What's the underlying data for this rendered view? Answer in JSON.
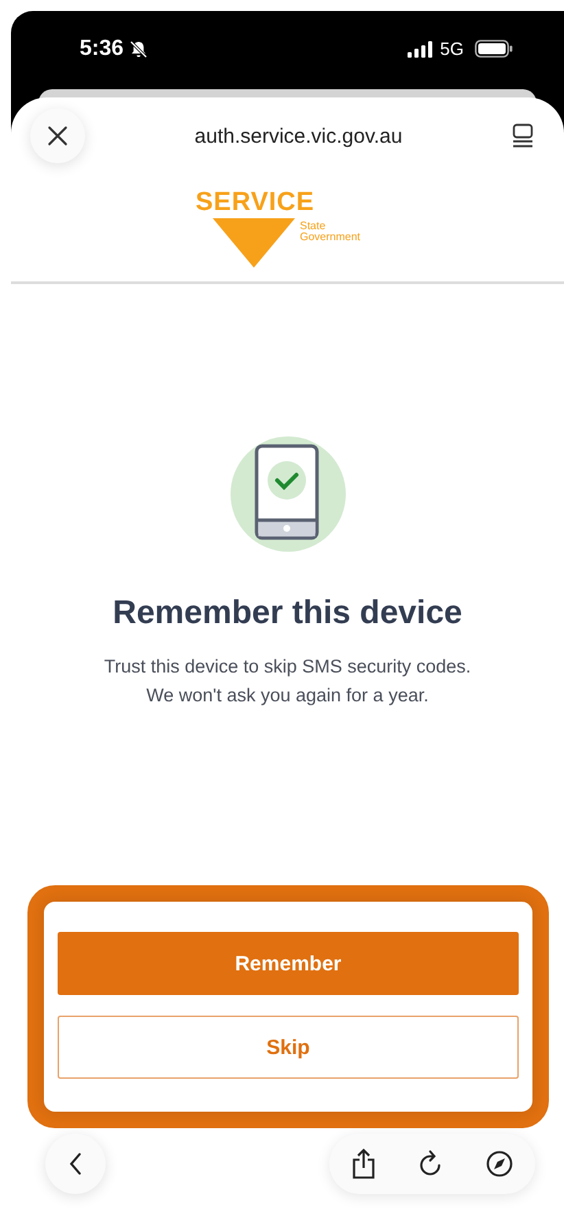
{
  "status_bar": {
    "time": "5:36",
    "network": "5G"
  },
  "browser": {
    "url": "auth.service.vic.gov.au"
  },
  "logo": {
    "wordmark": "SERVICE",
    "subtitle_1": "State",
    "subtitle_2": "Government"
  },
  "content": {
    "title": "Remember this device",
    "description": "Trust this device to skip SMS security codes. We won't ask you again for a year."
  },
  "buttons": [
    {
      "label": "Remember",
      "kind": "primary"
    },
    {
      "label": "Skip",
      "kind": "secondary"
    }
  ]
}
